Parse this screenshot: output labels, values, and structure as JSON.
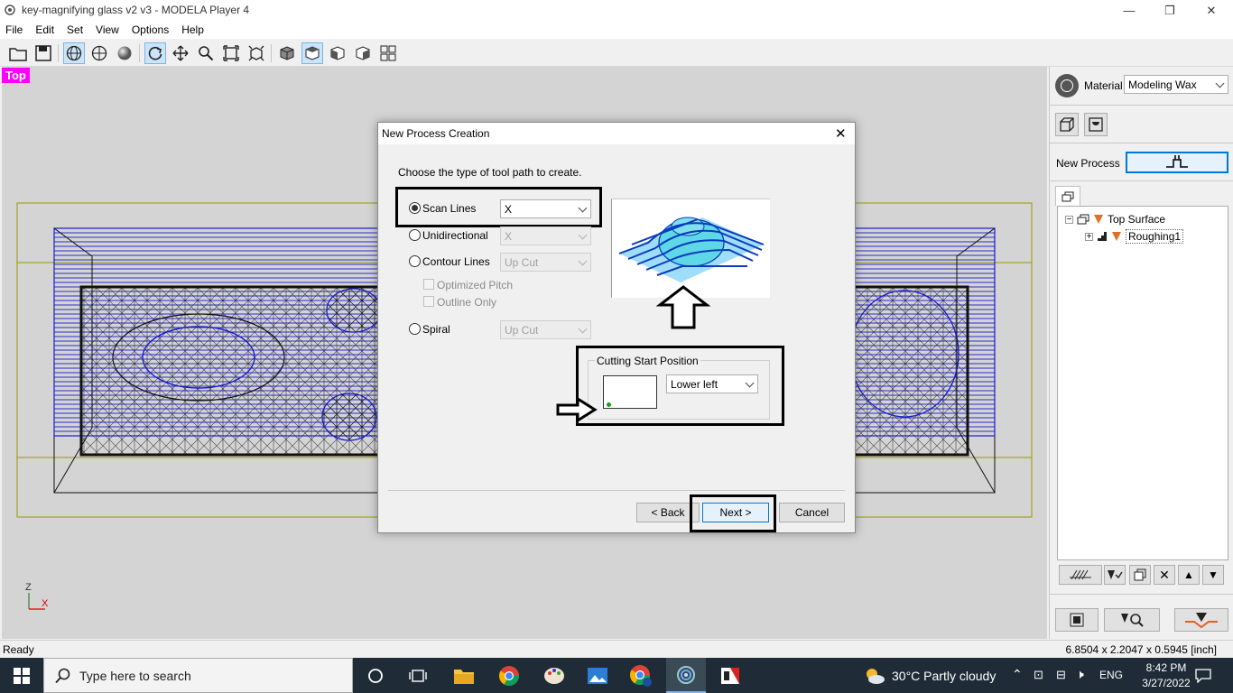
{
  "window": {
    "title": "key-magnifying glass v2 v3 - MODELA Player 4"
  },
  "menu": [
    "File",
    "Edit",
    "Set",
    "View",
    "Options",
    "Help"
  ],
  "viewport": {
    "view_label": "Top",
    "axis_z": "Z",
    "axis_x": "X"
  },
  "dialog": {
    "title": "New Process Creation",
    "instruction": "Choose the type of tool path to create.",
    "options": {
      "scan_lines": {
        "label": "Scan Lines",
        "value": "X"
      },
      "unidirectional": {
        "label": "Unidirectional",
        "value": "X"
      },
      "contour_lines": {
        "label": "Contour Lines",
        "value": "Up Cut"
      },
      "optimized_pitch": "Optimized Pitch",
      "outline_only": "Outline Only",
      "spiral": {
        "label": "Spiral",
        "value": "Up Cut"
      }
    },
    "cutting_start": {
      "legend": "Cutting Start Position",
      "value": "Lower left"
    },
    "buttons": {
      "back": "< Back",
      "next": "Next >",
      "cancel": "Cancel"
    }
  },
  "right_panel": {
    "material_label": "Material",
    "material_value": "Modeling Wax",
    "new_process_label": "New Process",
    "tree": {
      "root": "Top Surface",
      "child": "Roughing1"
    }
  },
  "status": {
    "left": "Ready",
    "right": "6.8504 x 2.2047 x 0.5945 [inch]"
  },
  "taskbar": {
    "search_placeholder": "Type here to search",
    "weather": "30°C  Partly cloudy",
    "lang": "ENG",
    "time": "8:42 PM",
    "date": "3/27/2022"
  },
  "colors": {
    "accent": "#0078d7",
    "highlight_label": "#ff00ff",
    "toolpath": "#0000cc"
  }
}
